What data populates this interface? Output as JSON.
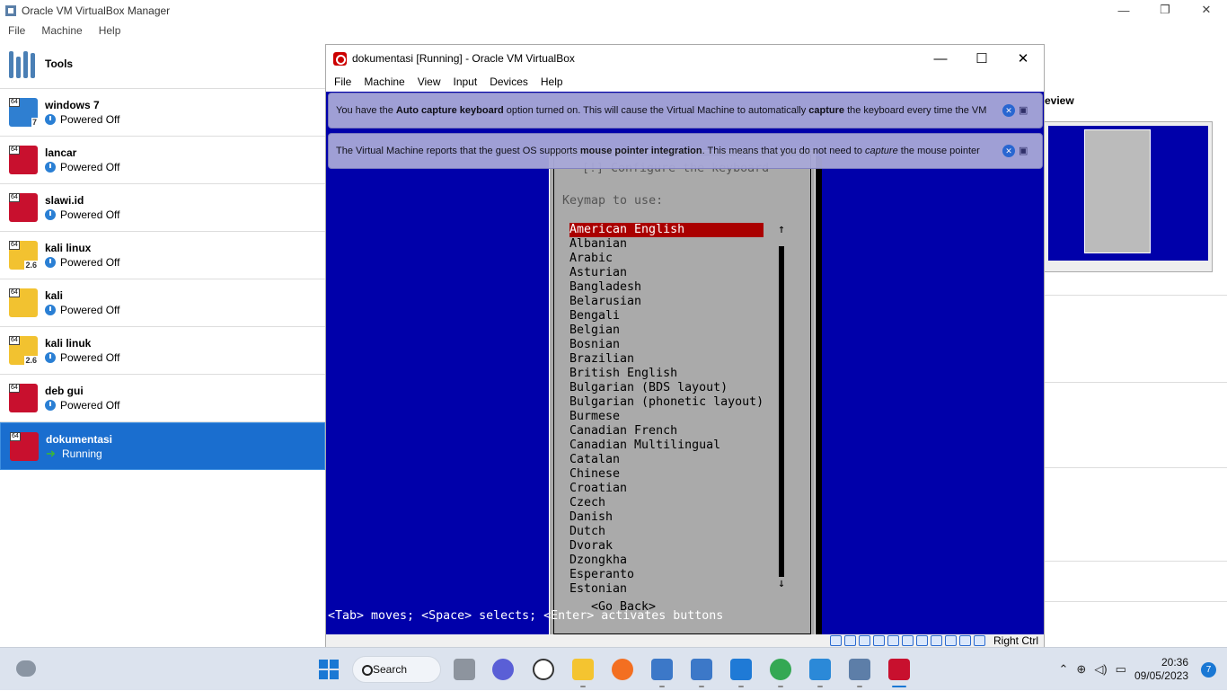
{
  "manager": {
    "title": "Oracle VM VirtualBox Manager",
    "menu": [
      "File",
      "Machine",
      "Help"
    ],
    "tools_label": "Tools",
    "preview_label": "eview",
    "vms": [
      {
        "name": "windows 7",
        "state": "Powered Off",
        "badge": "7"
      },
      {
        "name": "lancar",
        "state": "Powered Off",
        "badge": ""
      },
      {
        "name": "slawi.id",
        "state": "Powered Off",
        "badge": ""
      },
      {
        "name": "kali linux",
        "state": "Powered Off",
        "badge": "2.6"
      },
      {
        "name": "kali",
        "state": "Powered Off",
        "badge": ""
      },
      {
        "name": "kali linuk",
        "state": "Powered Off",
        "badge": "2.6"
      },
      {
        "name": "deb gui",
        "state": "Powered Off",
        "badge": ""
      },
      {
        "name": "dokumentasi",
        "state": "Running",
        "badge": ""
      }
    ],
    "badge64": "64"
  },
  "vm_window": {
    "title": "dokumentasi [Running] - Oracle VM VirtualBox",
    "menu": [
      "File",
      "Machine",
      "View",
      "Input",
      "Devices",
      "Help"
    ],
    "notice1_pre": "You have the ",
    "notice1_b1": "Auto capture keyboard",
    "notice1_mid": " option turned on. This will cause the Virtual Machine to automatically ",
    "notice1_b2": "capture",
    "notice1_post": " the keyboard every time the VM",
    "notice2_pre": "The Virtual Machine reports that the guest OS supports ",
    "notice2_b": "mouse pointer integration",
    "notice2_mid": ". This means that you do not need to ",
    "notice2_i": "capture",
    "notice2_post": " the mouse pointer",
    "host_key": "Right Ctrl"
  },
  "installer": {
    "dialog_title": "[!] Configure the keyboard",
    "keymap_label": "Keymap to use:",
    "keymaps": [
      "American English",
      "Albanian",
      "Arabic",
      "Asturian",
      "Bangladesh",
      "Belarusian",
      "Bengali",
      "Belgian",
      "Bosnian",
      "Brazilian",
      "British English",
      "Bulgarian (BDS layout)",
      "Bulgarian (phonetic layout)",
      "Burmese",
      "Canadian French",
      "Canadian Multilingual",
      "Catalan",
      "Chinese",
      "Croatian",
      "Czech",
      "Danish",
      "Dutch",
      "Dvorak",
      "Dzongkha",
      "Esperanto",
      "Estonian"
    ],
    "selected_index": 0,
    "go_back": "<Go Back>",
    "help_line": "<Tab> moves; <Space> selects; <Enter> activates buttons",
    "scroll_up": "↑",
    "scroll_down": "↓"
  },
  "taskbar": {
    "search_label": "Search",
    "time": "20:36",
    "date": "09/05/2023",
    "notification_count": "7"
  },
  "colors": {
    "accent": "#1a78d4",
    "vm_screen_bg": "#0000aa",
    "selection": "#aa0000"
  }
}
